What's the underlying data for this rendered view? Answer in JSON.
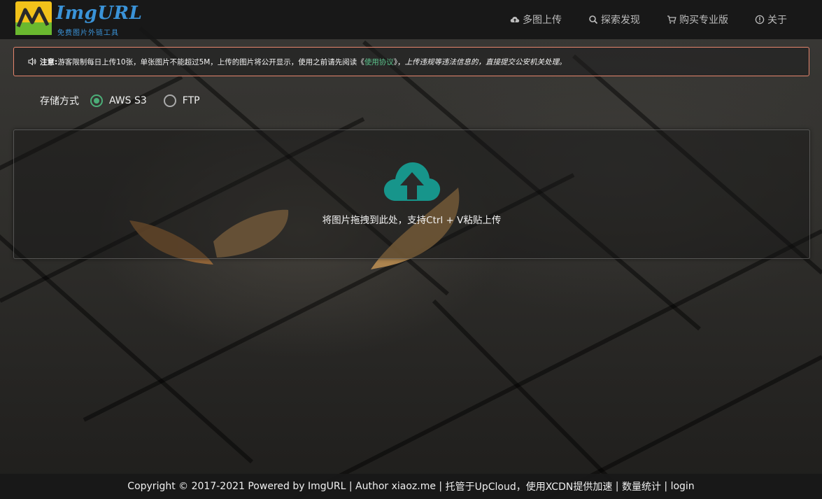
{
  "brand": {
    "name": "ImgURL",
    "tagline": "免费图片外链工具"
  },
  "nav": [
    {
      "icon": "cloud-upload-icon",
      "label": "多图上传"
    },
    {
      "icon": "search-icon",
      "label": "探索发现"
    },
    {
      "icon": "cart-icon",
      "label": "购买专业版"
    },
    {
      "icon": "info-icon",
      "label": "关于"
    }
  ],
  "notice": {
    "icon": "speaker-icon",
    "prefix": "注意:",
    "text": "游客限制每日上传10张，单张图片不能超过5M，上传的图片将公开显示，使用之前请先阅读《",
    "link": "使用协议",
    "after_link": "》，",
    "warning": "上传违规等违法信息的，直接提交公安机关处理。"
  },
  "storage": {
    "label": "存储方式",
    "options": [
      {
        "label": "AWS S3",
        "checked": true
      },
      {
        "label": "FTP",
        "checked": false
      }
    ]
  },
  "dropzone": {
    "icon": "cloud-upload-icon",
    "text": "将图片拖拽到此处，支持Ctrl + V粘贴上传"
  },
  "footer": {
    "copyright": "Copyright © 2017-2021 Powered by ImgURL",
    "author": "Author xiaoz.me",
    "hosting": "托管于UpCloud，使用XCDN提供加速",
    "stats": "数量统计",
    "login": "login",
    "separator": " | "
  },
  "colors": {
    "accent_green": "#4cae78",
    "upload_icon": "#17958b",
    "notice_border": "#e5856d",
    "link_green": "#5cc28c",
    "brand_blue": "#3a93d8"
  }
}
